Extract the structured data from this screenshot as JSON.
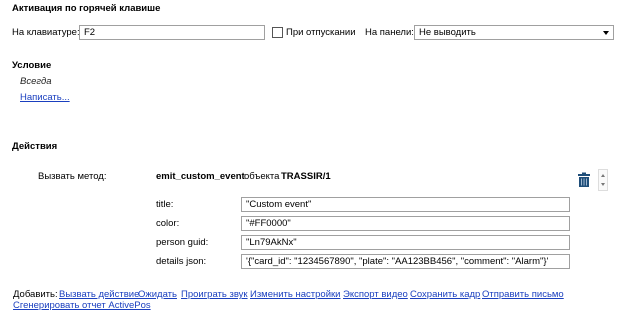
{
  "hotkey": {
    "section_title": "Активация по горячей клавише",
    "keyboard_label": "На клавиатуре:",
    "keyboard_value": "F2",
    "on_release_label": "При отпускании",
    "on_release_checked": false,
    "panel_label": "На панели:",
    "panel_value": "Не выводить"
  },
  "condition": {
    "section_title": "Условие",
    "value": "Всегда",
    "write_link": "Написать..."
  },
  "actions": {
    "section_title": "Действия",
    "call_method_label": "Вызвать метод:",
    "method_name": "emit_custom_event",
    "object_word": "объекта",
    "object_name": "TRASSIR/1",
    "params": [
      {
        "label": "title:",
        "value": "\"Custom event\""
      },
      {
        "label": "color:",
        "value": "\"#FF0000\""
      },
      {
        "label": "person guid:",
        "value": "\"Ln79AkNx\""
      },
      {
        "label": "details json:",
        "value": "'{\"card_id\": \"1234567890\", \"plate\": \"AA123BB456\", \"comment\": \"Alarm\"}'"
      }
    ]
  },
  "add": {
    "label": "Добавить:",
    "links": [
      "Вызвать действие",
      "Ожидать",
      "Проиграть звук",
      "Изменить настройки",
      "Экспорт видео",
      "Сохранить кадр",
      "Отправить письмо",
      "Сгенерировать отчет ActivePos"
    ]
  },
  "colors": {
    "link": "#1a3fbf",
    "trash_icon": "#1f4e79"
  },
  "icons": {
    "trash": "trash-icon",
    "dropdown": "chevron-down-icon"
  }
}
